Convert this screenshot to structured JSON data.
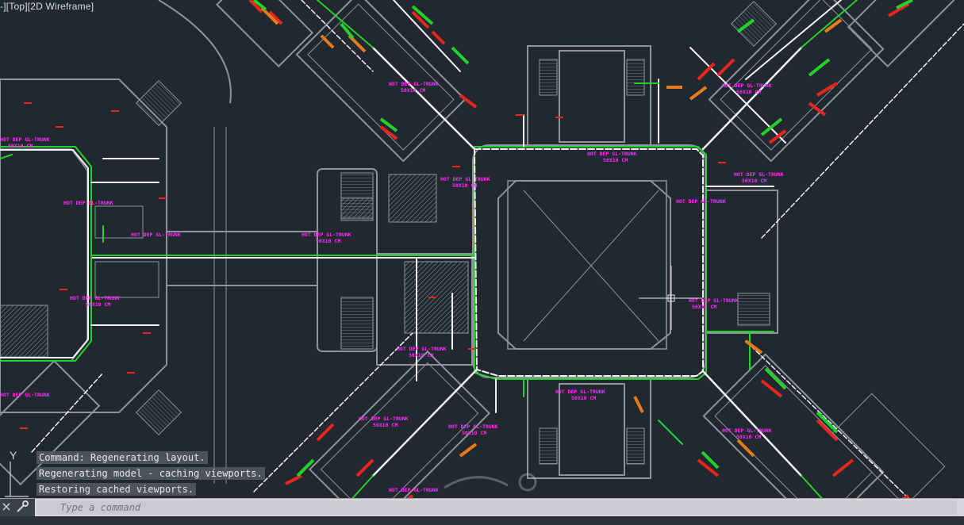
{
  "viewport": {
    "controls": "-][Top][2D Wireframe]"
  },
  "ucs": {
    "y_label": "Y"
  },
  "command_history": [
    "Command: Regenerating layout.",
    "Regenerating model - caching viewports.",
    "Restoring cached viewports."
  ],
  "command_line": {
    "placeholder": "Type a command"
  },
  "annotations": {
    "trunk_a": "HOT DEP GL-TRUNK",
    "trunk_b": "50X10 CM",
    "trunk_c": "50X10 CM"
  },
  "colors": {
    "background": "#212830",
    "wall": "#9ea3a8",
    "duct_white": "#f2f2f2",
    "duct_green": "#23d12b",
    "magenta": "#ff2bff",
    "red": "#e8261e",
    "orange": "#e57b1a"
  },
  "icons": [
    "ucs-icon",
    "wrench-icon",
    "close-icon",
    "command-prompt-icon"
  ]
}
